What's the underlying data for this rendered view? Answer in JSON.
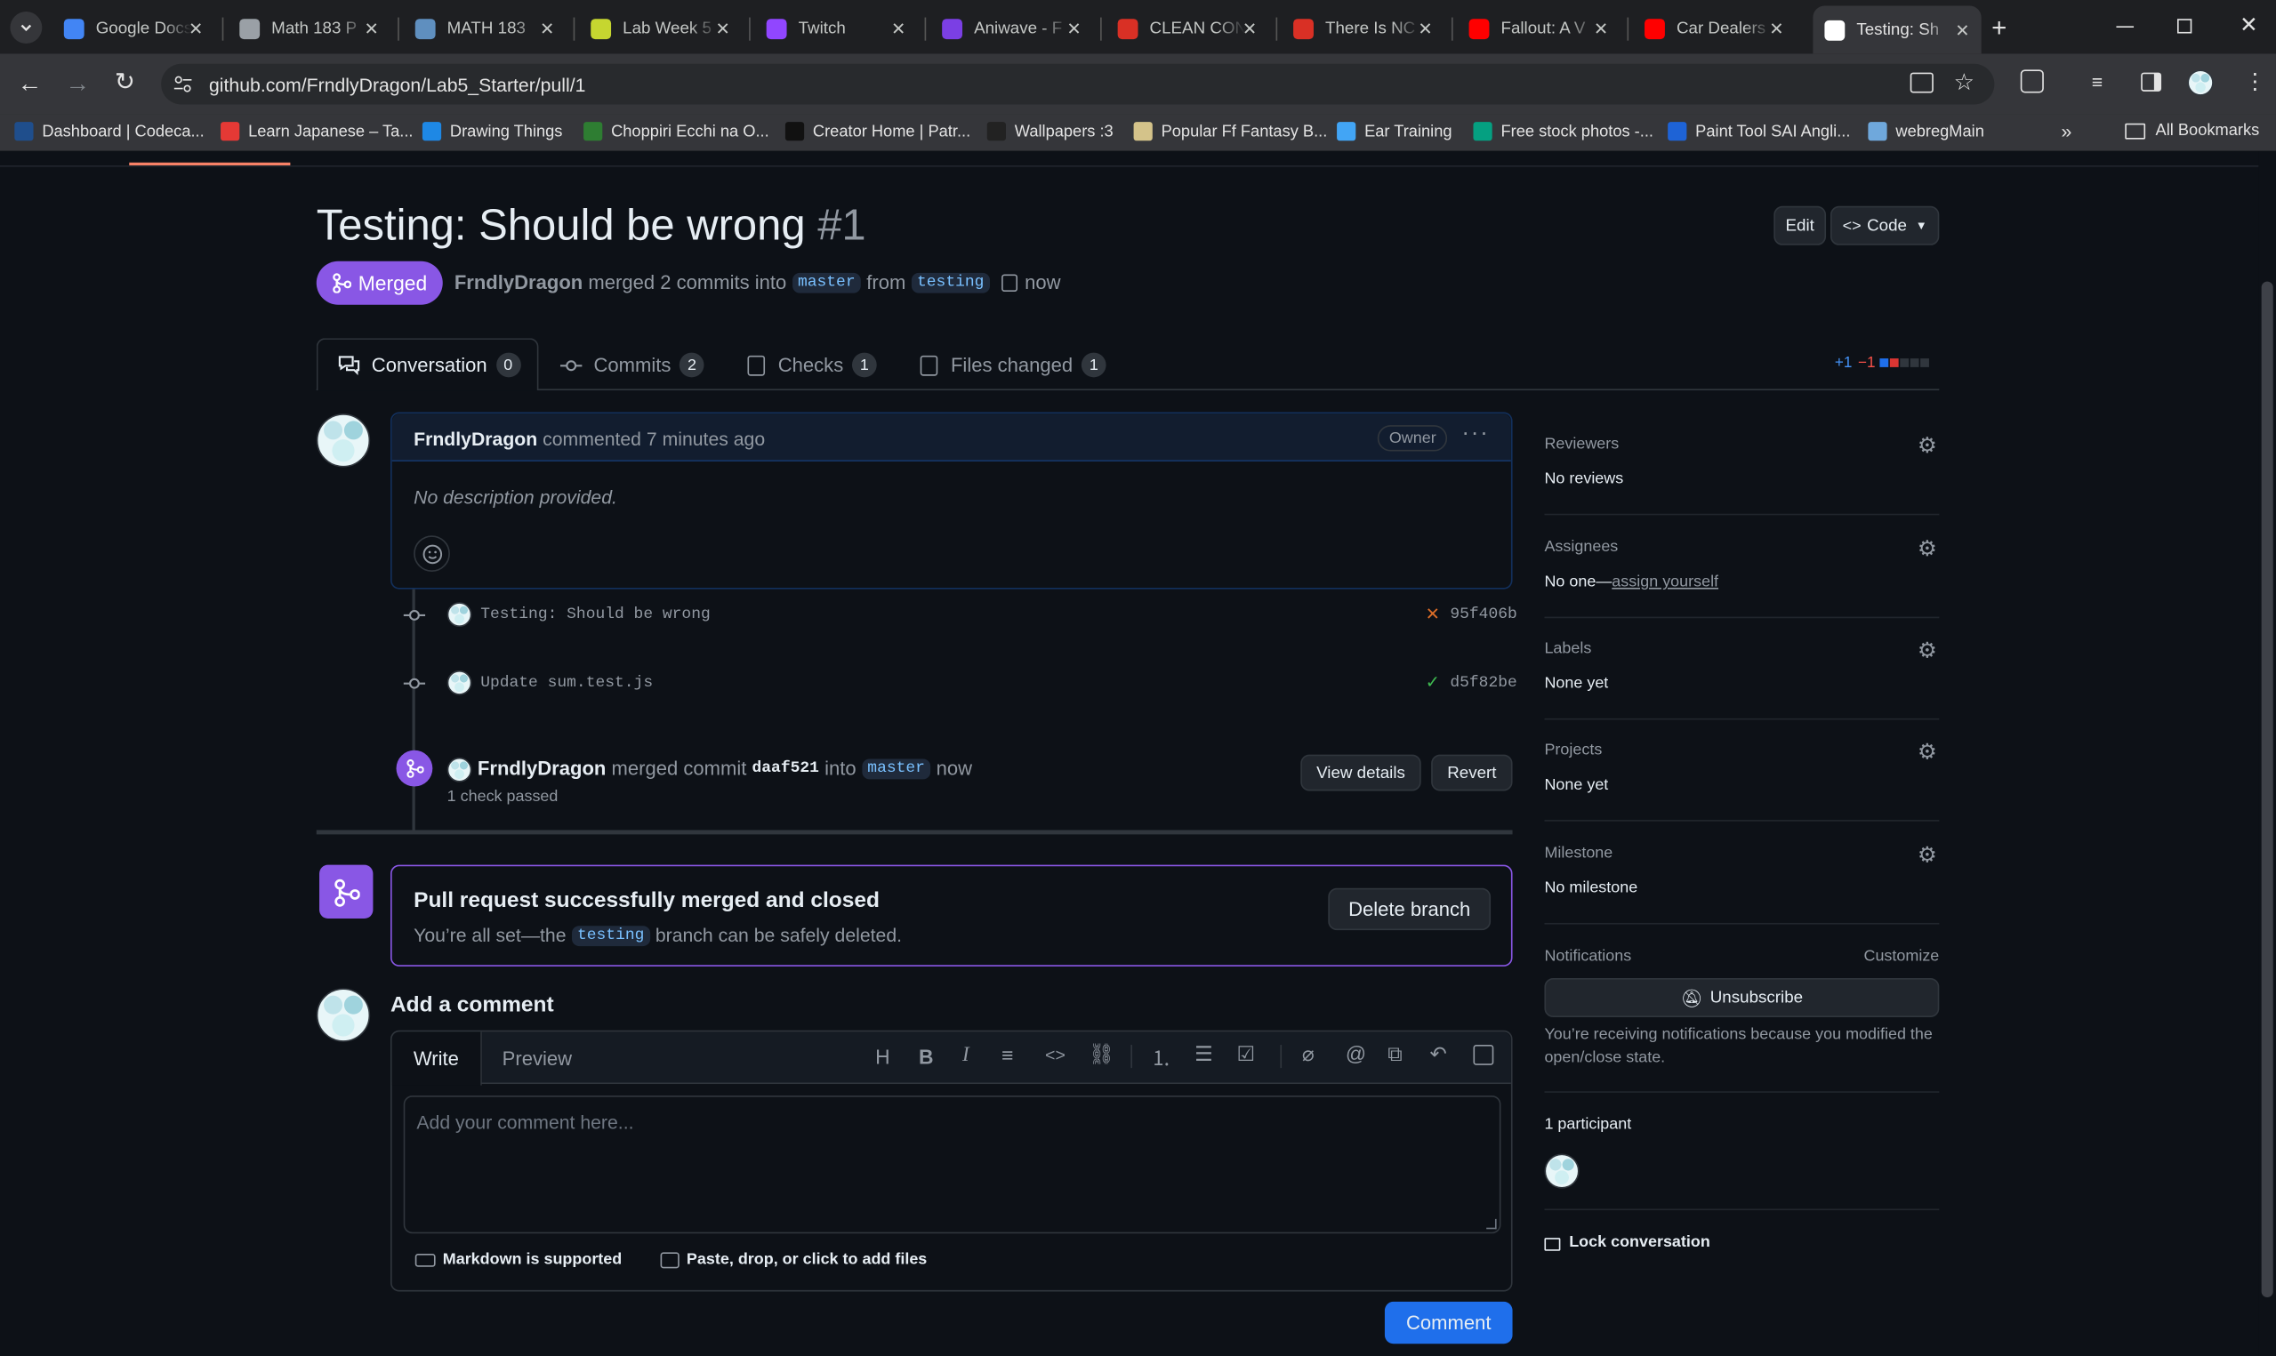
{
  "browser": {
    "tabs": [
      {
        "title": "Google Docs",
        "color": "#4285f4"
      },
      {
        "title": "Math 183 P",
        "color": "#9aa0a6"
      },
      {
        "title": "MATH 183",
        "color": "#5f8fbf"
      },
      {
        "title": "Lab Week 5",
        "color": "#c6d630"
      },
      {
        "title": "Twitch",
        "color": "#9146ff"
      },
      {
        "title": "Aniwave - F",
        "color": "#7b3fe4"
      },
      {
        "title": "CLEAN CON",
        "color": "#d93025"
      },
      {
        "title": "There Is NC",
        "color": "#d93025"
      },
      {
        "title": "Fallout: A V",
        "color": "#ff0000"
      },
      {
        "title": "Car Dealers",
        "color": "#ff0000"
      },
      {
        "title": "Testing: Sh",
        "color": "#ffffff"
      }
    ],
    "url": "github.com/FrndlyDragon/Lab5_Starter/pull/1",
    "bookmarks": [
      {
        "label": "Dashboard | Codeca...",
        "color": "#1f4e8c"
      },
      {
        "label": "Learn Japanese – Ta...",
        "color": "#e53935"
      },
      {
        "label": "Drawing Things",
        "color": "#1e88e5"
      },
      {
        "label": "Choppiri Ecchi na O...",
        "color": "#2e7d32"
      },
      {
        "label": "Creator Home | Patr...",
        "color": "#111111"
      },
      {
        "label": "Wallpapers :3",
        "color": "#222222"
      },
      {
        "label": "Popular Ff Fantasy B...",
        "color": "#d4c38a"
      },
      {
        "label": "Ear Training",
        "color": "#42a5f5"
      },
      {
        "label": "Free stock photos -...",
        "color": "#05a081"
      },
      {
        "label": "Paint Tool SAI Angli...",
        "color": "#1e63d6"
      },
      {
        "label": "webregMain",
        "color": "#6fa8dc"
      }
    ],
    "all_bookmarks": "All Bookmarks"
  },
  "pr": {
    "title": "Testing: Should be wrong",
    "number": "#1",
    "state": "Merged",
    "author": "FrndlyDragon",
    "merge_text": "merged 2 commits into",
    "base": "master",
    "from_text": "from",
    "head": "testing",
    "time": "now",
    "edit": "Edit",
    "code": "Code"
  },
  "tabs": [
    {
      "label": "Conversation",
      "count": "0"
    },
    {
      "label": "Commits",
      "count": "2"
    },
    {
      "label": "Checks",
      "count": "1"
    },
    {
      "label": "Files changed",
      "count": "1"
    }
  ],
  "diffstat": {
    "add": "+1",
    "del": "−1"
  },
  "comment": {
    "author": "FrndlyDragon",
    "meta": "commented 7 minutes ago",
    "role": "Owner",
    "body": "No description provided."
  },
  "commits": [
    {
      "message": "Testing: Should be wrong",
      "sha": "95f406b",
      "status": "fail"
    },
    {
      "message": "Update sum.test.js",
      "sha": "d5f82be",
      "status": "pass"
    }
  ],
  "merge_event": {
    "author": "FrndlyDragon",
    "text1": "merged commit",
    "sha": "daaf521",
    "text2": "into",
    "branch": "master",
    "time": "now",
    "checks": "1 check passed",
    "view_details": "View details",
    "revert": "Revert"
  },
  "merged_box": {
    "title": "Pull request successfully merged and closed",
    "desc1": "You’re all set—the",
    "branch": "testing",
    "desc2": "branch can be safely deleted.",
    "button": "Delete branch"
  },
  "add_comment": {
    "heading": "Add a comment",
    "write": "Write",
    "preview": "Preview",
    "placeholder": "Add your comment here...",
    "markdown": "Markdown is supported",
    "files": "Paste, drop, or click to add files",
    "submit": "Comment"
  },
  "sidebar": {
    "reviewers": {
      "label": "Reviewers",
      "value": "No reviews"
    },
    "assignees": {
      "label": "Assignees",
      "value": "No one—",
      "link": "assign yourself"
    },
    "labels": {
      "label": "Labels",
      "value": "None yet"
    },
    "projects": {
      "label": "Projects",
      "value": "None yet"
    },
    "milestone": {
      "label": "Milestone",
      "value": "No milestone"
    },
    "notifications": {
      "label": "Notifications",
      "customize": "Customize",
      "button": "Unsubscribe",
      "note": "You’re receiving notifications because you modified the open/close state."
    },
    "participants": "1 participant",
    "lock": "Lock conversation"
  }
}
